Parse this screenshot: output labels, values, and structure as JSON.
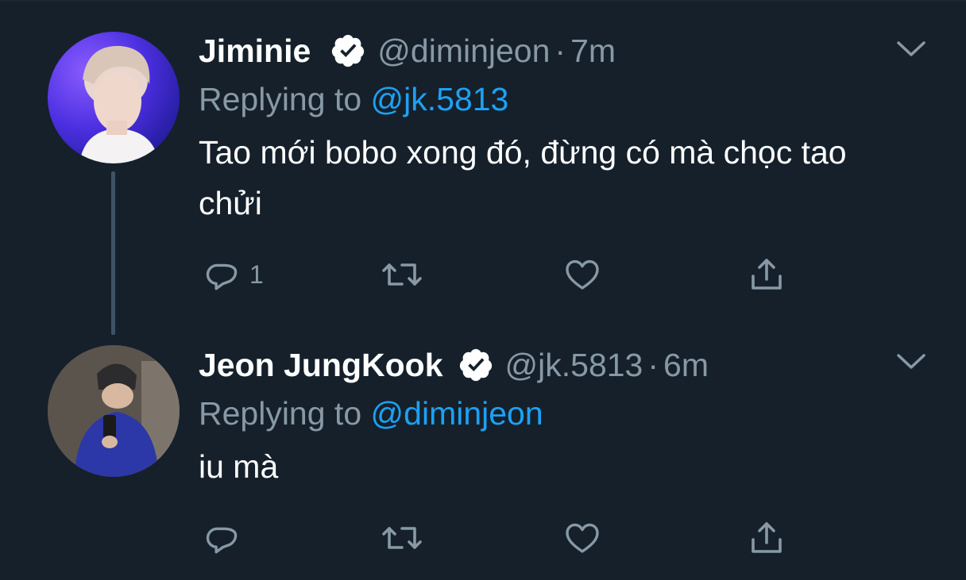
{
  "tweets": [
    {
      "display_name": "Jiminie",
      "handle": "@diminjeon",
      "separator": "·",
      "time": "7m",
      "replying_prefix": "Replying to",
      "replying_to": "@jk.5813",
      "text": "Tao mới bobo xong đó, đừng có mà chọc tao chửi",
      "reply_count": "1",
      "avatar_icon": "avatar-photo-jiminie"
    },
    {
      "display_name": "Jeon JungKook",
      "handle": "@jk.5813",
      "separator": "·",
      "time": "6m",
      "replying_prefix": "Replying to",
      "replying_to": "@diminjeon",
      "text": "iu mà",
      "reply_count": "",
      "avatar_icon": "avatar-photo-jungkook"
    }
  ],
  "colors": {
    "background": "#15202b",
    "text": "#ffffff",
    "secondary": "#8899a6",
    "accent": "#1da1f2",
    "thread_line": "#3d5466"
  },
  "icons": [
    "verified-badge-icon",
    "chevron-down-icon",
    "reply-icon",
    "retweet-icon",
    "like-icon",
    "share-icon"
  ]
}
